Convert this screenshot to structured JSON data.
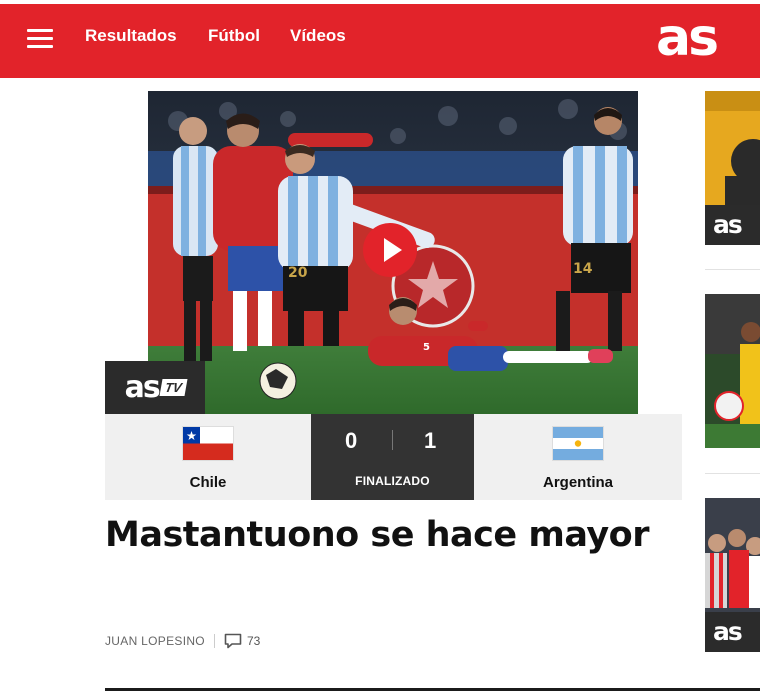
{
  "header": {
    "nav": [
      "Resultados",
      "Fútbol",
      "Vídeos"
    ],
    "logo": "as",
    "accent_color": "#e2232a",
    "menu_icon": "hamburger-icon"
  },
  "hero": {
    "badge_as": "as",
    "badge_tv": "TV",
    "play_icon": "play-icon"
  },
  "match": {
    "home_team": "Chile",
    "away_team": "Argentina",
    "home_score": "0",
    "away_score": "1",
    "status": "FINALIZADO"
  },
  "article": {
    "headline": "Mastantuono se hace mayor",
    "author": "JUAN LOPESINO",
    "comments_icon": "comment-icon",
    "comments_count": "73"
  },
  "sidebar": {
    "badge_label": "as"
  }
}
